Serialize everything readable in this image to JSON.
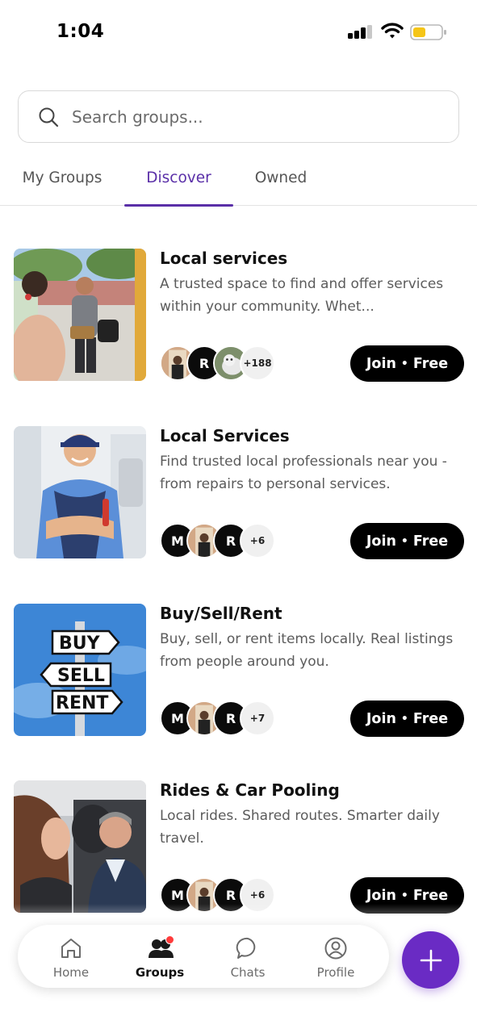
{
  "status_bar": {
    "time": "1:04"
  },
  "search": {
    "placeholder": "Search groups..."
  },
  "tabs": [
    {
      "label": "My Groups",
      "active": false
    },
    {
      "label": "Discover",
      "active": true
    },
    {
      "label": "Owned",
      "active": false
    }
  ],
  "groups": [
    {
      "title": "Local services",
      "description": "A trusted space to find and offer services within your community. Whet...",
      "member_avatars": [
        "photo",
        "R",
        "photo-cat"
      ],
      "more_count": "+188",
      "join_label": "Join",
      "price_label": "Free"
    },
    {
      "title": "Local Services",
      "description": "Find trusted local professionals near you -from repairs to personal services.",
      "member_avatars": [
        "M",
        "photo",
        "R"
      ],
      "more_count": "+6",
      "join_label": "Join",
      "price_label": "Free"
    },
    {
      "title": "Buy/Sell/Rent",
      "description": "Buy, sell, or rent items locally. Real listings from people around you.",
      "member_avatars": [
        "M",
        "photo",
        "R"
      ],
      "more_count": "+7",
      "join_label": "Join",
      "price_label": "Free"
    },
    {
      "title": "Rides & Car Pooling",
      "description": "Local rides. Shared routes. Smarter daily travel.",
      "member_avatars": [
        "M",
        "photo",
        "R"
      ],
      "more_count": "+6",
      "join_label": "Join",
      "price_label": "Free"
    }
  ],
  "signpost": {
    "buy": "BUY",
    "sell": "SELL",
    "rent": "RENT"
  },
  "bottom_nav": [
    {
      "label": "Home",
      "icon": "home-icon",
      "active": false
    },
    {
      "label": "Groups",
      "icon": "groups-icon",
      "active": true
    },
    {
      "label": "Chats",
      "icon": "chat-icon",
      "active": false
    },
    {
      "label": "Profile",
      "icon": "profile-icon",
      "active": false
    }
  ],
  "colors": {
    "accent": "#5a2fa8",
    "fab": "#6a2bc4",
    "button": "#000000",
    "battery": "#f5c518"
  }
}
